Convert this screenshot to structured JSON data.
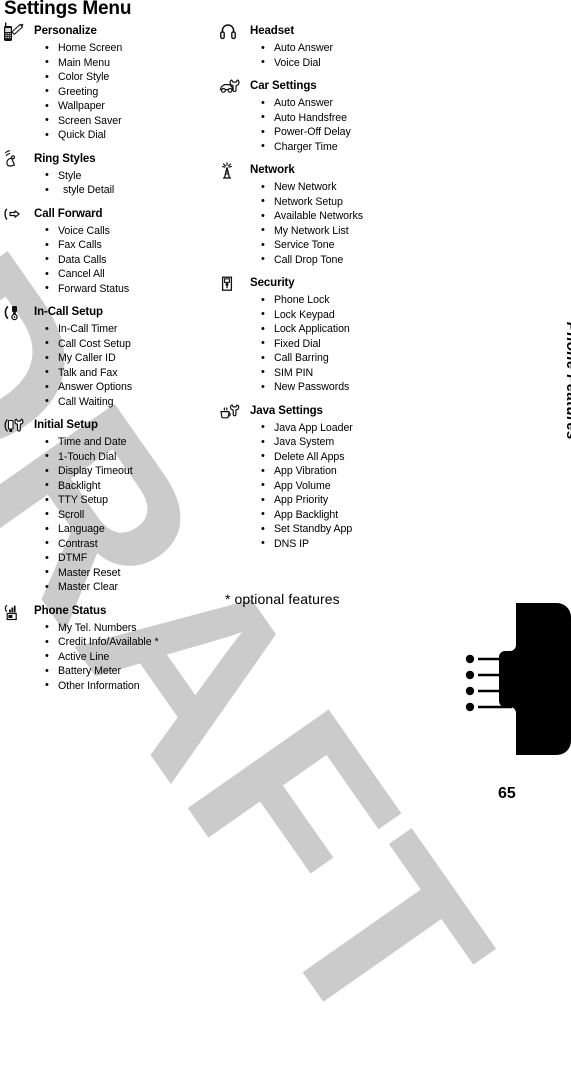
{
  "page": {
    "title": "Settings Menu",
    "number": "65",
    "watermark": "DRAFT",
    "footnote": "* optional features",
    "side_tab_label": "Phone Features"
  },
  "columns": {
    "left": [
      {
        "icon": "phone-pencil-icon",
        "title": "Personalize",
        "items": [
          "Home Screen",
          "Main Menu",
          "Color Style",
          "Greeting",
          "Wallpaper",
          "Screen Saver",
          "Quick Dial"
        ]
      },
      {
        "icon": "ringer-bell-icon",
        "title": "Ring Styles",
        "items": [
          "Style",
          "style Detail"
        ]
      },
      {
        "icon": "call-forward-arrow-icon",
        "title": "Call Forward",
        "items": [
          "Voice Calls",
          "Fax Calls",
          "Data Calls",
          "Cancel All",
          "Forward Status"
        ]
      },
      {
        "icon": "handset-wrench-icon",
        "title": "In-Call Setup",
        "items": [
          "In-Call Timer",
          "Call Cost Setup",
          "My Caller ID",
          "Talk and Fax",
          "Answer Options",
          "Call Waiting"
        ]
      },
      {
        "icon": "tools-wrench-icon",
        "title": "Initial Setup",
        "items": [
          "Time and Date",
          "1-Touch Dial",
          "Display Timeout",
          "Backlight",
          "TTY Setup",
          "Scroll",
          "Language",
          "Contrast",
          "DTMF",
          "Master Reset",
          "Master Clear"
        ]
      },
      {
        "icon": "signal-battery-icon",
        "title": "Phone Status",
        "items": [
          "My Tel. Numbers",
          "Credit Info/Available *",
          "Active Line",
          "Battery Meter",
          "Other Information"
        ]
      }
    ],
    "right": [
      {
        "icon": "headset-icon",
        "title": "Headset",
        "items": [
          "Auto Answer",
          "Voice Dial"
        ]
      },
      {
        "icon": "car-wrench-icon",
        "title": "Car Settings",
        "items": [
          "Auto Answer",
          "Auto Handsfree",
          "Power-Off Delay",
          "Charger Time"
        ]
      },
      {
        "icon": "network-tower-icon",
        "title": "Network",
        "items": [
          "New Network",
          "Network Setup",
          "Available Networks",
          "My Network List",
          "Service Tone",
          "Call Drop Tone"
        ]
      },
      {
        "icon": "padlock-icon",
        "title": "Security",
        "items": [
          "Phone Lock",
          "Lock Keypad",
          "Lock Application",
          "Fixed Dial",
          "Call Barring",
          "SIM PIN",
          "New Passwords"
        ]
      },
      {
        "icon": "java-cup-wrench-icon",
        "title": "Java Settings",
        "items": [
          "Java App Loader",
          "Java System",
          "Delete All Apps",
          "App Vibration",
          "App Volume",
          "App Priority",
          "App Backlight",
          "Set Standby App",
          "DNS IP"
        ]
      }
    ]
  },
  "colors": {
    "text": "#000000",
    "watermark": "#c9c9c9",
    "page_background": "#ffffff",
    "tab_graphic": "#000000"
  }
}
